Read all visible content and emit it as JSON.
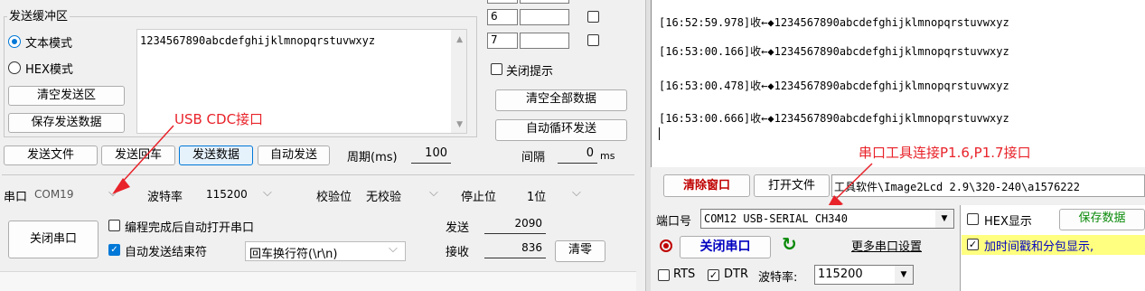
{
  "left": {
    "group_title": "发送缓冲区",
    "mode_text": "文本模式",
    "mode_hex": "HEX模式",
    "buf_content": "1234567890abcdefghijklmnopqrstuvwxyz",
    "btn_clear_send": "清空发送区",
    "btn_save_send": "保存发送数据",
    "btn_send_file": "发送文件",
    "btn_send_enter": "发送回车",
    "btn_send_data": "发送数据",
    "btn_auto_send": "自动发送",
    "period_label": "周期(ms)",
    "period_value": "100",
    "multi_rows": [
      "6",
      "7"
    ],
    "close_tip": "关闭提示",
    "btn_clear_all": "清空全部数据",
    "btn_auto_loop": "自动循环发送",
    "interval_label": "间隔",
    "interval_value": "0",
    "interval_unit": "ms",
    "port_label": "串口",
    "port_value": "COM19",
    "baud_label": "波特率",
    "baud_value": "115200",
    "parity_label": "校验位",
    "parity_value": "无校验",
    "stop_label": "停止位",
    "stop_value": "1位",
    "btn_close_port": "关闭串口",
    "auto_open": "编程完成后自动打开串口",
    "auto_end": "自动发送结束符",
    "end_value": "回车换行符(\\r\\n)",
    "sent_label": "发送",
    "sent_value": "2090",
    "recv_label": "接收",
    "recv_value": "836",
    "btn_clear_count": "清零",
    "annotation": "USB CDC接口"
  },
  "right": {
    "log_lines": [
      "[16:52:59.978]收←◆1234567890abcdefghijklmnopqrstuvwxyz",
      "[16:53:00.166]收←◆1234567890abcdefghijklmnopqrstuvwxyz",
      "[16:53:00.478]收←◆1234567890abcdefghijklmnopqrstuvwxyz",
      "[16:53:00.666]收←◆1234567890abcdefghijklmnopqrstuvwxyz"
    ],
    "annotation": "串口工具连接P1.6,P1.7接口",
    "btn_clear_window": "清除窗口",
    "btn_open_file": "打开文件",
    "path_value": "工具软件\\Image2Lcd 2.9\\320-240\\a1576222",
    "port_label": "端口号",
    "port_value": "COM12 USB-SERIAL CH340",
    "hex_display": "HEX显示",
    "btn_save_data": "保存数据",
    "btn_close_port": "关闭串口",
    "btn_more_settings": "更多串口设置",
    "timestamp_option": "加时间戳和分包显示,",
    "rts": "RTS",
    "dtr": "DTR",
    "baud_label": "波特率:",
    "baud_value": "115200"
  },
  "colors": {
    "annotation": "#e8232a",
    "accent": "#0078d7",
    "check_yellow": "#ffff80"
  }
}
